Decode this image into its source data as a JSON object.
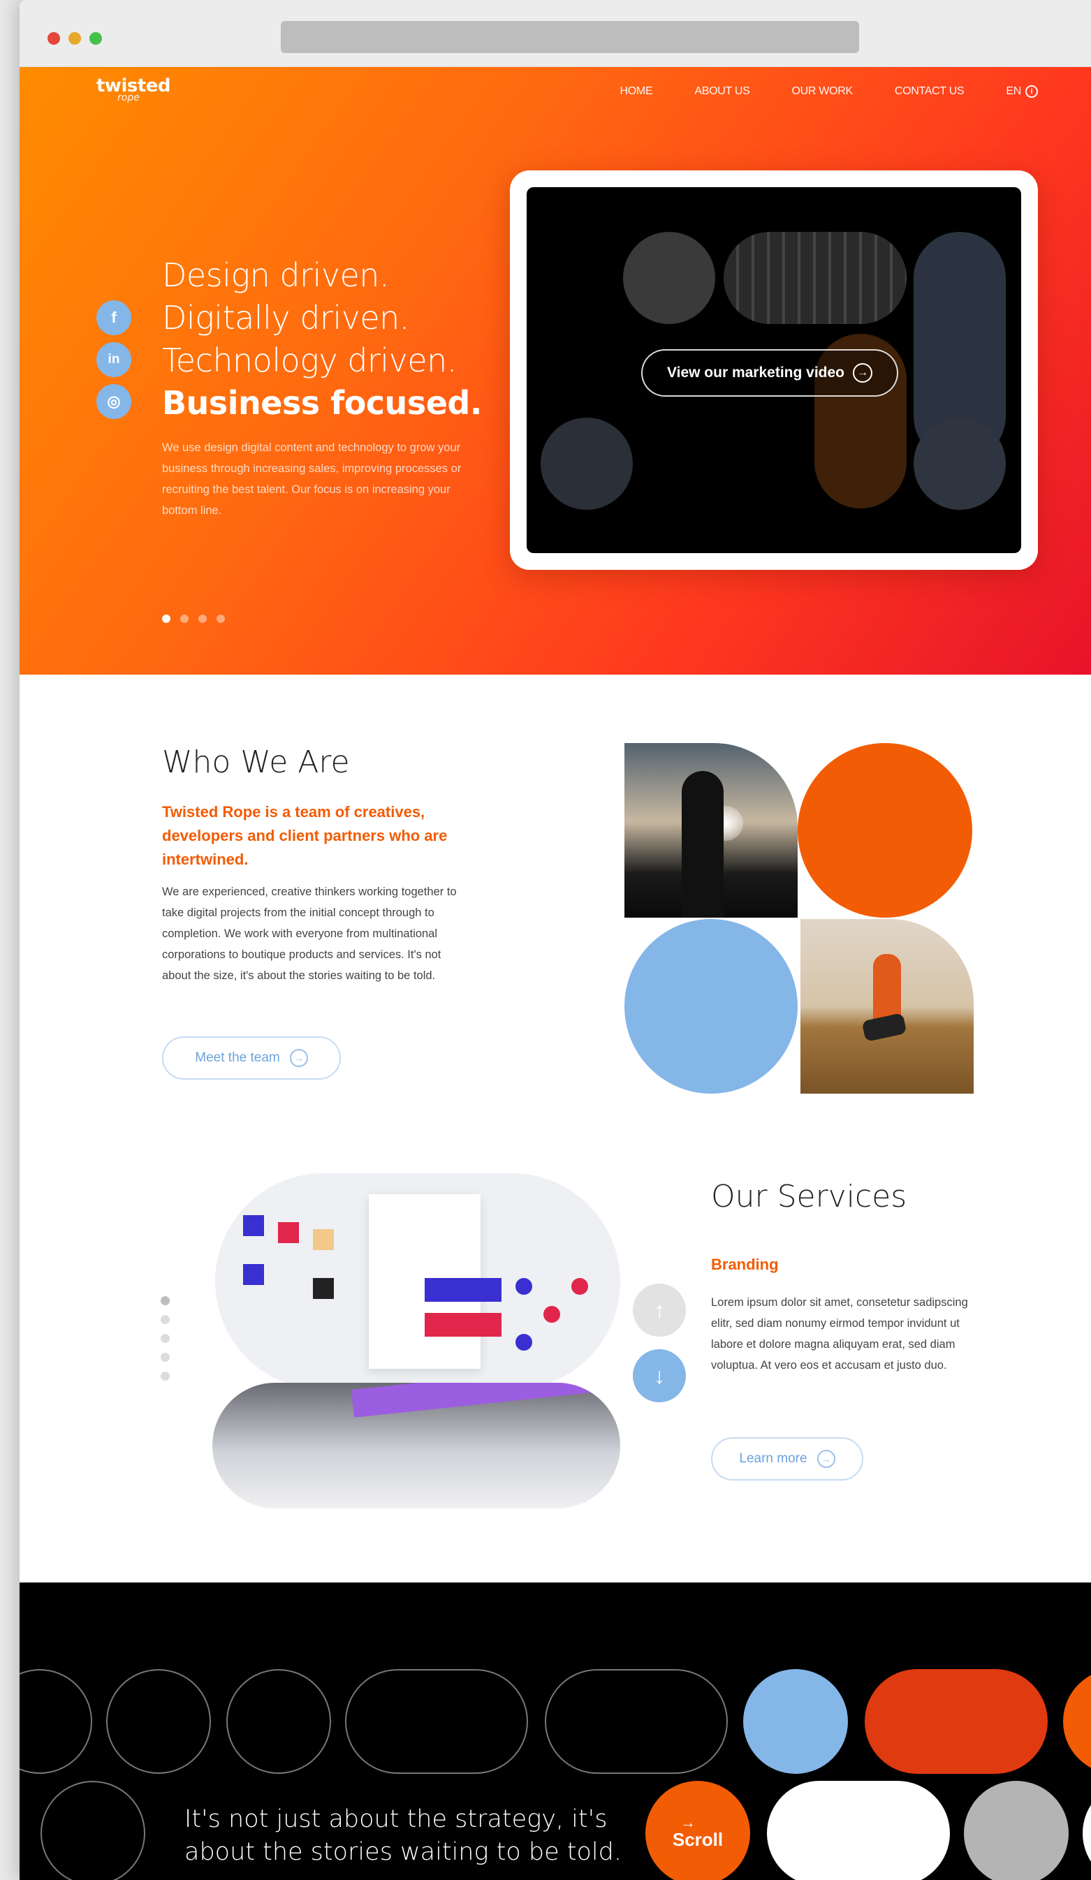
{
  "nav": {
    "logo_main": "twisted",
    "logo_sub": "rope",
    "items": [
      "HOME",
      "ABOUT US",
      "OUR WORK",
      "CONTACT US"
    ],
    "language": "EN"
  },
  "hero": {
    "headline": [
      "Design driven.",
      "Digitally driven.",
      "Technology driven."
    ],
    "headline_bold": "Business focused.",
    "description": "We use design digital content and technology to grow your business through increasing sales, improving processes or recruiting the best talent. Our focus is on increasing your bottom line.",
    "video_button": "View our marketing video",
    "social": [
      {
        "icon": "facebook-icon",
        "glyph": "f"
      },
      {
        "icon": "linkedin-icon",
        "glyph": "in"
      },
      {
        "icon": "instagram-icon",
        "glyph": "◎"
      }
    ],
    "slides": {
      "count": 4,
      "active": 1
    }
  },
  "who": {
    "title": "Who We Are",
    "subtitle": "Twisted Rope is a team of creatives, developers and client partners who are intertwined.",
    "body": "We are experienced, creative thinkers working together to take digital projects from the initial concept through to completion. We work with everyone from multinational corporations to boutique products and services. It's not about the size, it's about the stories waiting to be told.",
    "button": "Meet the team"
  },
  "services": {
    "title": "Our Services",
    "subtitle": "Branding",
    "body": "Lorem ipsum dolor sit amet, consetetur sadipscing elitr, sed diam nonumy eirmod tempor invidunt ut labore et dolore magna aliquyam erat, sed diam voluptua. At vero eos et accusam et justo duo.",
    "button": "Learn more",
    "slides": {
      "count": 5,
      "active": 1
    }
  },
  "footer_band": {
    "tagline_line1": "It's not just about the strategy, it's",
    "tagline_line2": "about the stories waiting to be told.",
    "scroll_button": "Scroll"
  },
  "colors": {
    "accent_orange": "#f25c05",
    "accent_red": "#e8132a",
    "accent_blue": "#84b6e8",
    "dark": "#000000"
  }
}
